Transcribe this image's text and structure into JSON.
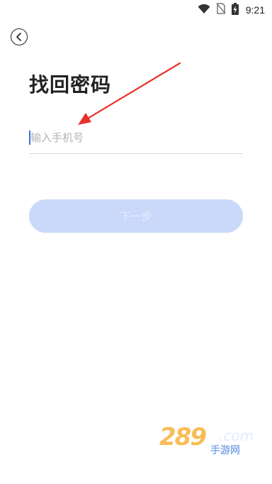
{
  "status_bar": {
    "time": "9:21"
  },
  "header": {
    "title": "找回密码"
  },
  "form": {
    "phone_placeholder": "输入手机号",
    "phone_value": ""
  },
  "actions": {
    "next_label": "下一步"
  },
  "watermark": {
    "number": "289",
    "domain": ".com",
    "site_name": "手游网"
  },
  "colors": {
    "accent": "#3a73e8",
    "button_disabled_bg": "#cad8fa",
    "arrow": "#e8312b"
  },
  "icons": {
    "status": [
      "wifi-icon",
      "no-sim-icon",
      "battery-charging-icon"
    ],
    "back": "back-chevron-icon"
  }
}
